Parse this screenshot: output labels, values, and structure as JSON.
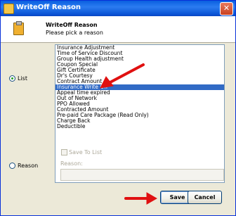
{
  "window": {
    "title": "WriteOff Reason",
    "close_glyph": "✕"
  },
  "header": {
    "title": "WriteOff Reason",
    "subtitle": "Please pick a reason"
  },
  "options": {
    "list_label": "List",
    "reason_label": "Reason",
    "selected": "list"
  },
  "list": {
    "items": [
      "Insurance Adjustment",
      "Time of Service Discount",
      "Group Health adjustment",
      "Coupon Special",
      "Gift Certificate",
      "Dr's Courtesy",
      "Contract Amount",
      "Insurance Write Off",
      "Appeal time expired",
      "Out of Network",
      "PPO Allowed",
      "Contracted Amount",
      "Pre-paid Care Package (Read Only)",
      "Charge Back",
      "Deductible"
    ],
    "selected_index": 7
  },
  "reason_section": {
    "save_to_list_label": "Save To List",
    "reason_field_label": "Reason:",
    "reason_value": ""
  },
  "buttons": {
    "save": "Save",
    "cancel": "Cancel"
  },
  "icons": {
    "app": "clipboard-icon",
    "header": "clipboard-icon",
    "annotation": "red-arrow-icon"
  },
  "colors": {
    "selection": "#316ac5",
    "annotation_arrow": "#e01010",
    "title_bar": "#0a5fe0"
  }
}
